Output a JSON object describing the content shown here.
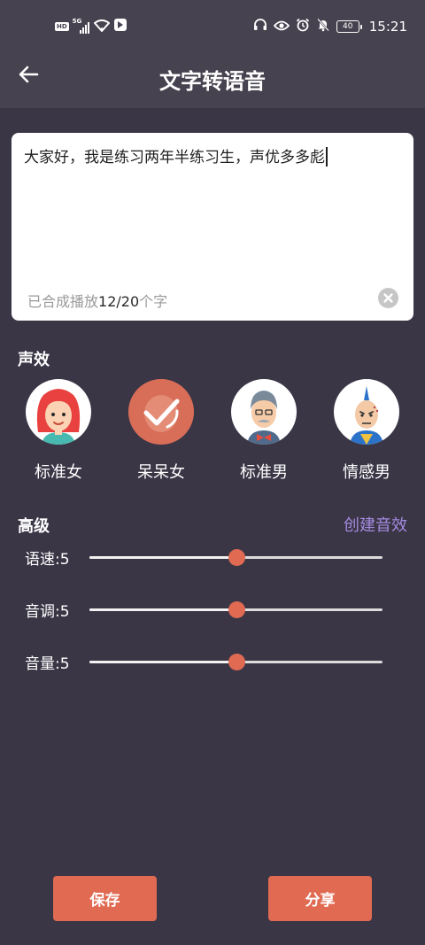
{
  "status_bar": {
    "hd_label": "HD",
    "network_label": "5G",
    "battery_level": "40",
    "time": "15:21"
  },
  "header": {
    "title": "文字转语音"
  },
  "editor": {
    "text": "大家好，我是练习两年半练习生，声优多多彪",
    "counter_prefix": "已合成播放",
    "counter_value": "12/20",
    "counter_suffix": "个字"
  },
  "voice_effects": {
    "label": "声效",
    "selected_index": 1,
    "items": [
      {
        "label": "标准女",
        "icon": "female-standard-avatar"
      },
      {
        "label": "呆呆女",
        "icon": "female-cute-avatar"
      },
      {
        "label": "标准男",
        "icon": "male-standard-avatar"
      },
      {
        "label": "情感男",
        "icon": "male-emotional-avatar"
      }
    ]
  },
  "advanced": {
    "label": "高级",
    "create_label": "创建音效",
    "params": [
      {
        "label": "语速:5",
        "value": 5,
        "max": 10
      },
      {
        "label": "音调:5",
        "value": 5,
        "max": 10
      },
      {
        "label": "音量:5",
        "value": 5,
        "max": 10
      }
    ]
  },
  "footer": {
    "save_label": "保存",
    "share_label": "分享"
  },
  "colors": {
    "background": "#3a3646",
    "header": "#46424f",
    "accent": "#e06a52",
    "link": "#a58be0"
  }
}
